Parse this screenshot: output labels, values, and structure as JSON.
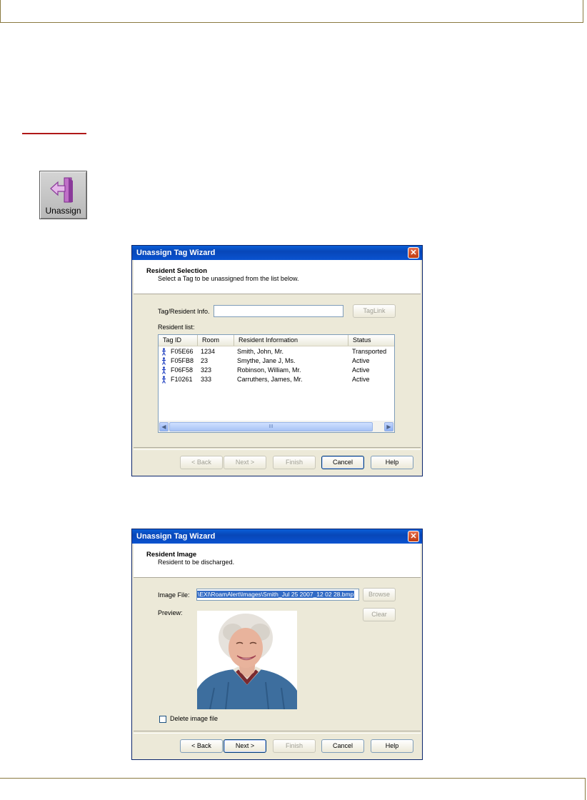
{
  "unassign_button": {
    "label": "Unassign"
  },
  "dialog1": {
    "title": "Unassign Tag Wizard",
    "heading": "Resident Selection",
    "subheading": "Select a Tag to be unassigned from the list below.",
    "tag_info_label": "Tag/Resident Info.",
    "tag_info_value": "",
    "taglink_label": "TagLink",
    "resident_list_label": "Resident list:",
    "columns": [
      "Tag ID",
      "Room",
      "Resident Information",
      "Status"
    ],
    "rows": [
      {
        "tag_id": "F05E66",
        "room": "1234",
        "info": "Smith, John, Mr.",
        "status": "Transported"
      },
      {
        "tag_id": "F05FB8",
        "room": "23",
        "info": "Smythe, Jane J, Ms.",
        "status": "Active"
      },
      {
        "tag_id": "F06F58",
        "room": "323",
        "info": "Robinson, William, Mr.",
        "status": "Active"
      },
      {
        "tag_id": "F10261",
        "room": "333",
        "info": "Carruthers, James, Mr.",
        "status": "Active"
      }
    ],
    "scroll_thumb": "III",
    "buttons": {
      "back": "< Back",
      "next": "Next >",
      "finish": "Finish",
      "cancel": "Cancel",
      "help": "Help"
    }
  },
  "dialog2": {
    "title": "Unassign Tag Wizard",
    "heading": "Resident Image",
    "subheading": "Resident to be discharged.",
    "image_file_label": "Image File:",
    "image_file_value": "\\EXI\\RoamAlert\\Images\\Smith_Jul 25 2007_12 02 28.bmp",
    "browse_label": "Browse",
    "preview_label": "Preview:",
    "clear_label": "Clear",
    "delete_checkbox_label": "Delete image file",
    "delete_checked": false,
    "buttons": {
      "back": "< Back",
      "next": "Next >",
      "finish": "Finish",
      "cancel": "Cancel",
      "help": "Help"
    }
  },
  "colors": {
    "titlebar": "#0a53d0",
    "dialog_bg": "#ece9d8",
    "accent_rule": "#b01818",
    "selection": "#316ac5"
  }
}
